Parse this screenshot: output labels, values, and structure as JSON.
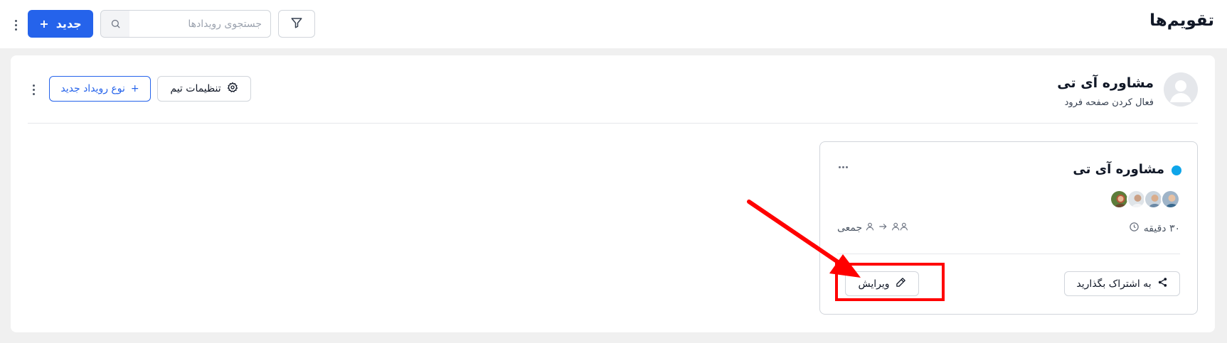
{
  "header": {
    "page_title": "تقویم‌ها",
    "new_button_label": "جدید",
    "new_button_plus": "+",
    "search": {
      "placeholder": "جستجوی رویدادها",
      "value": ""
    },
    "icons": {
      "filter": "filter-icon",
      "search": "search-icon",
      "more": "vertical-dots-icon"
    }
  },
  "team": {
    "name": "مشاوره آی تی",
    "subtitle": "فعال کردن صفحه فرود",
    "settings_button_label": "تنظیمات تیم",
    "new_event_type_label": "نوع رویداد جدید",
    "new_event_type_plus": "+",
    "icons": {
      "avatar": "user-avatar-placeholder",
      "settings": "gear-icon",
      "more": "vertical-dots-icon"
    }
  },
  "event_card": {
    "title": "مشاوره آی تی",
    "status_color": "#0ea5e9",
    "participant_count": 4,
    "duration": "۳۰ دقیقه",
    "type_label": "جمعی",
    "share_button_label": "به اشتراک بگذارید",
    "edit_button_label": "ویرایش",
    "icons": {
      "more": "horizontal-dots-icon",
      "clock": "clock-icon",
      "users": "users-icon",
      "arrow": "arrow-right-icon",
      "user": "user-icon",
      "share": "share-icon",
      "edit": "pencil-icon"
    }
  },
  "annotation": {
    "color": "#ff0000",
    "target": "edit-button"
  },
  "colors": {
    "primary": "#2563eb",
    "background": "#f0f0f0",
    "card": "#ffffff",
    "border": "#d1d5db"
  }
}
